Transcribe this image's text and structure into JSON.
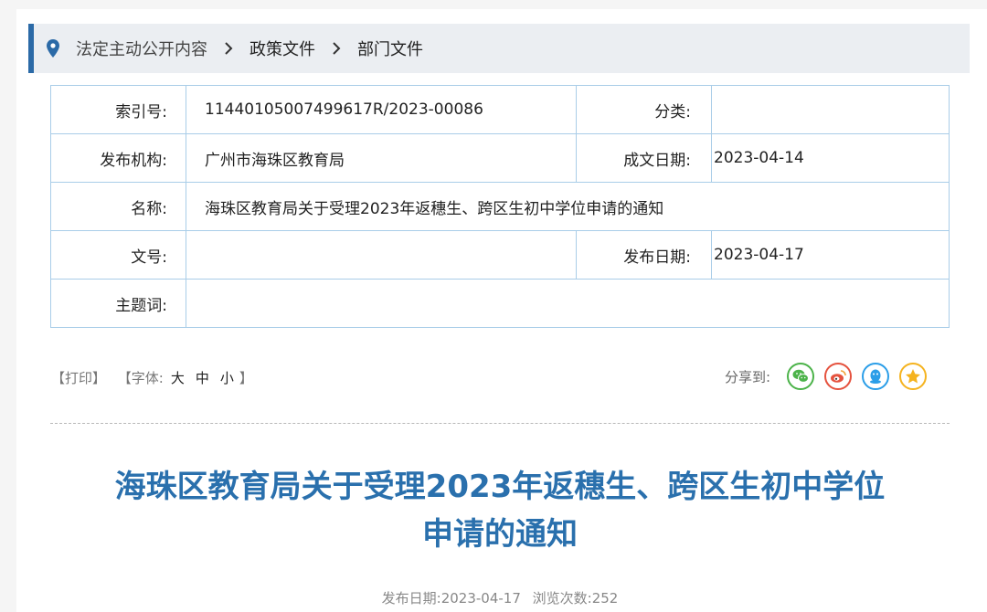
{
  "breadcrumb": {
    "items": [
      "法定主动公开内容",
      "政策文件",
      "部门文件"
    ]
  },
  "meta": {
    "index_label": "索引号:",
    "index_value": "11440105007499617R/2023-00086",
    "category_label": "分类:",
    "category_value": "",
    "publisher_label": "发布机构:",
    "publisher_value": "广州市海珠区教育局",
    "created_label": "成文日期:",
    "created_value": "2023-04-14",
    "name_label": "名称:",
    "name_value": "海珠区教育局关于受理2023年返穗生、跨区生初中学位申请的通知",
    "docno_label": "文号:",
    "docno_value": "",
    "published_label": "发布日期:",
    "published_value": "2023-04-17",
    "keywords_label": "主题词:",
    "keywords_value": ""
  },
  "tools": {
    "print": "【打印】",
    "font_prefix": "【字体:",
    "size_large": "大",
    "size_medium": "中",
    "size_small": "小",
    "font_suffix": "】",
    "share_label": "分享到:"
  },
  "share_icons": [
    "wechat-icon",
    "weibo-icon",
    "qq-icon",
    "qzone-icon"
  ],
  "colors": {
    "accent": "#2b6aa7",
    "title": "#2a70ad",
    "border": "#a9cde8",
    "wechat": "#4cb34a",
    "weibo": "#e5523e",
    "qq": "#2b9ee8",
    "qzone": "#f5b31f"
  },
  "article": {
    "title_line1": "海珠区教育局关于受理2023年返穗生、跨区生初中学位",
    "title_line2": "申请的通知",
    "date_label": "发布日期:",
    "date_value": "2023-04-17",
    "views_label": "浏览次数:",
    "views_value": "252"
  }
}
